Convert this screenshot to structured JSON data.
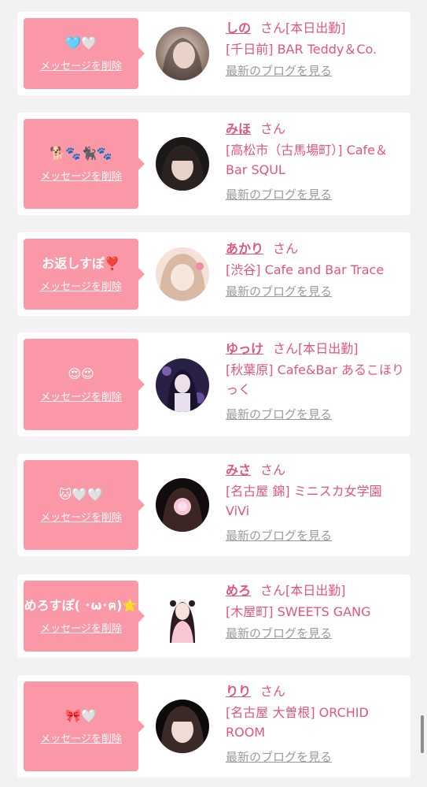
{
  "cards": [
    {
      "message": "🩵🤍",
      "delete_label": "メッセージを削除",
      "name": "しの",
      "san": "さん",
      "status": "[本日出勤]",
      "shop": "[千日前] BAR Teddy＆Co.",
      "blog_link": "最新のブログを見る",
      "avatar_colors": [
        "#d9c7be",
        "#3a2e2a"
      ]
    },
    {
      "message": "🐕🐾🐈‍⬛🐾",
      "delete_label": "メッセージを削除",
      "name": "みほ",
      "san": "さん",
      "status": "",
      "shop": "[高松市（古馬場町）] Cafe＆Bar SQUL",
      "blog_link": "最新のブログを見る",
      "avatar_colors": [
        "#a89a92",
        "#1c1818"
      ]
    },
    {
      "message": "お返しすぽ❣️",
      "delete_label": "メッセージを削除",
      "name": "あかり",
      "san": "さん",
      "status": "",
      "shop": "[渋谷] Cafe and Bar Trace",
      "blog_link": "最新のブログを見る",
      "avatar_colors": [
        "#f3d9cc",
        "#b78c70"
      ]
    },
    {
      "message": "😍😍",
      "delete_label": "メッセージを削除",
      "name": "ゆっけ",
      "san": "さん",
      "status": "[本日出勤]",
      "shop": "[秋葉原] Cafe&Bar あるこほりっく",
      "blog_link": "最新のブログを見る",
      "avatar_colors": [
        "#6b4f9e",
        "#1a1330"
      ]
    },
    {
      "message": "🐱🤍🤍",
      "delete_label": "メッセージを削除",
      "name": "みさ",
      "san": "さん",
      "status": "",
      "shop": "[名古屋 錦] ミニスカ女学園ViVi",
      "blog_link": "最新のブログを見る",
      "avatar_colors": [
        "#4a2c2a",
        "#120c0c"
      ]
    },
    {
      "message": "めろすぽ( ･ω･ฅ)⭐️",
      "delete_label": "メッセージを削除",
      "name": "めろ",
      "san": "さん",
      "status": "[本日出勤]",
      "shop": "[木屋町] SWEETS GANG",
      "blog_link": "最新のブログを見る",
      "avatar_colors": [
        "#ffffff",
        "#f7c8d4"
      ]
    },
    {
      "message": "🎀🤍",
      "delete_label": "メッセージを削除",
      "name": "りり",
      "san": "さん",
      "status": "",
      "shop": "[名古屋 大曽根] ORCHID ROOM",
      "blog_link": "最新のブログを見る",
      "avatar_colors": [
        "#3a2a28",
        "#0e0a0a"
      ]
    }
  ]
}
